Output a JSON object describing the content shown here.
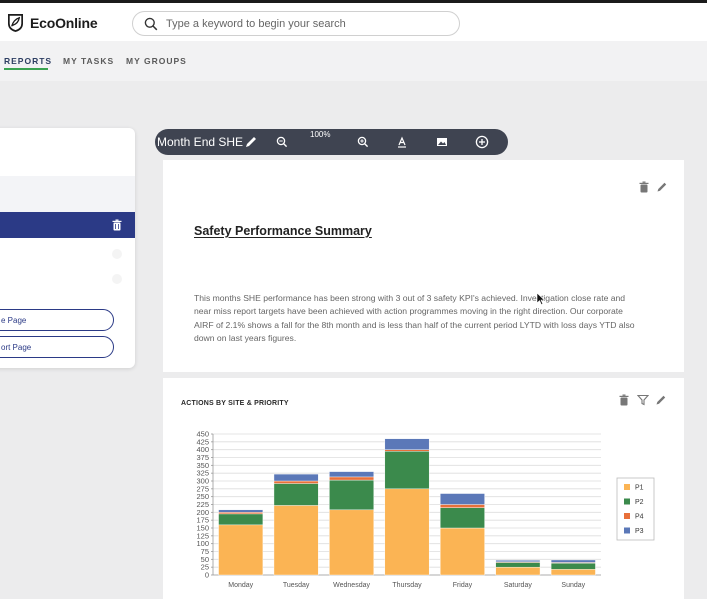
{
  "app": {
    "logo_text": "EcoOnline"
  },
  "search": {
    "placeholder": "Type a keyword to begin your search"
  },
  "nav": {
    "items": [
      {
        "label": "REPORTS",
        "active": true
      },
      {
        "label": "MY TASKS"
      },
      {
        "label": "MY GROUPS"
      }
    ]
  },
  "panel": {
    "buttons": [
      "e Page",
      "ort Page"
    ]
  },
  "toolbar": {
    "title": "Month End SHE",
    "zoom": "100%"
  },
  "summary": {
    "title": "Safety Performance Summary",
    "body": "This months SHE performance has been strong with 3 out of 3 safety KPI's achieved. Investigation close rate and near miss report targets have been achieved with action programmes moving in the right direction.  Our corporate AIRF of 2.1% shows a fall for the 8th month and is less than half of the current period LYTD with loss days YTD also down on last years figures."
  },
  "colors": {
    "accent": "#2b3a86",
    "nav_underline": "#3aa351",
    "toolbar_bg": "#3f4451"
  },
  "chart_data": {
    "type": "bar",
    "stacked": true,
    "title": "ACTIONS BY SITE & PRIORITY",
    "categories": [
      "Monday",
      "Tuesday",
      "Wednesday",
      "Thursday",
      "Friday",
      "Saturday",
      "Sunday"
    ],
    "series": [
      {
        "name": "P1",
        "color": "#fbb454",
        "values": [
          160,
          222,
          208,
          275,
          150,
          25,
          18
        ]
      },
      {
        "name": "P2",
        "color": "#3b8a4c",
        "values": [
          35,
          70,
          95,
          120,
          65,
          15,
          20
        ]
      },
      {
        "name": "P4",
        "color": "#e8703a",
        "values": [
          5,
          8,
          10,
          5,
          10,
          2,
          2
        ]
      },
      {
        "name": "P3",
        "color": "#5b78b8",
        "values": [
          8,
          22,
          17,
          35,
          35,
          5,
          8
        ]
      }
    ],
    "y_ticks": [
      "0",
      "25",
      "50",
      "75",
      "100",
      "125",
      "150",
      "175",
      "200",
      "225",
      "250",
      "275",
      "300",
      "325",
      "350",
      "375",
      "400",
      "425",
      "450"
    ],
    "ylim": [
      0,
      450
    ],
    "grid": true,
    "legend": "right"
  }
}
